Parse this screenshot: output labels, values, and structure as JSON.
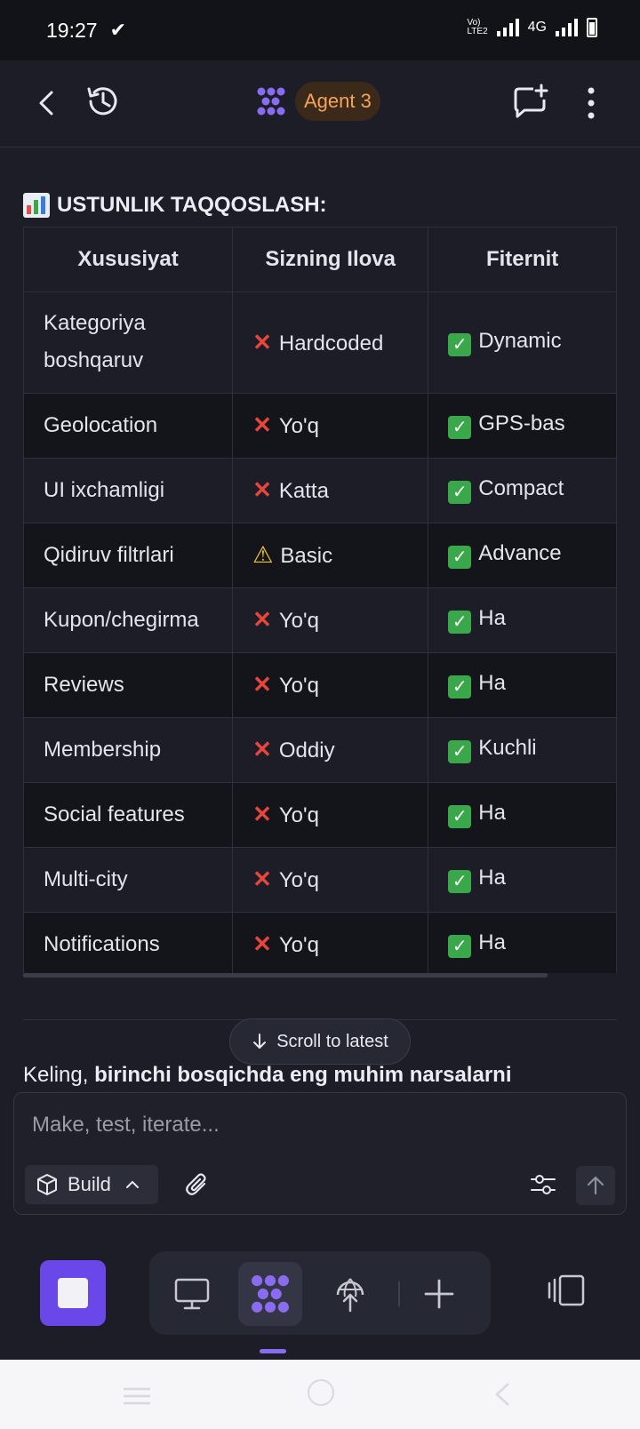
{
  "status_bar": {
    "time": "19:27",
    "network": "4G"
  },
  "header": {
    "agent_label": "Agent 3"
  },
  "section": {
    "title": "USTUNLIK TAQQOSLASH:"
  },
  "table": {
    "headers": [
      "Xususiyat",
      "Sizning Ilova",
      "Fiternit"
    ],
    "rows": [
      {
        "feature": "Kategoriya boshqaruv",
        "ours_icon": "cross",
        "ours": "Hardcoded",
        "theirs_icon": "check",
        "theirs": "Dynamic"
      },
      {
        "feature": "Geolocation",
        "ours_icon": "cross",
        "ours": "Yo'q",
        "theirs_icon": "check",
        "theirs": "GPS-bas"
      },
      {
        "feature": "UI ixchamligi",
        "ours_icon": "cross",
        "ours": "Katta",
        "theirs_icon": "check",
        "theirs": "Compact"
      },
      {
        "feature": "Qidiruv filtrlari",
        "ours_icon": "warning",
        "ours": "Basic",
        "theirs_icon": "check",
        "theirs": "Advance"
      },
      {
        "feature": "Kupon/chegirma",
        "ours_icon": "cross",
        "ours": "Yo'q",
        "theirs_icon": "check",
        "theirs": "Ha"
      },
      {
        "feature": "Reviews",
        "ours_icon": "cross",
        "ours": "Yo'q",
        "theirs_icon": "check",
        "theirs": "Ha"
      },
      {
        "feature": "Membership",
        "ours_icon": "cross",
        "ours": "Oddiy",
        "theirs_icon": "check",
        "theirs": "Kuchli"
      },
      {
        "feature": "Social features",
        "ours_icon": "cross",
        "ours": "Yo'q",
        "theirs_icon": "check",
        "theirs": "Ha"
      },
      {
        "feature": "Multi-city",
        "ours_icon": "cross",
        "ours": "Yo'q",
        "theirs_icon": "check",
        "theirs": "Ha"
      },
      {
        "feature": "Notifications",
        "ours_icon": "cross",
        "ours": "Yo'q",
        "theirs_icon": "check",
        "theirs": "Ha"
      }
    ]
  },
  "scroll_button": {
    "label": "Scroll to latest"
  },
  "paragraph": {
    "prefix": "Keling, ",
    "bold": "birinchi bosqichda eng muhim narsalarni"
  },
  "composer": {
    "placeholder": "Make, test, iterate...",
    "mode_label": "Build"
  },
  "colors": {
    "accent": "#6a47e8",
    "agent_badge_text": "#f5a45a",
    "cross": "#e8453c",
    "check": "#3aa84a",
    "warning": "#f2c230"
  }
}
